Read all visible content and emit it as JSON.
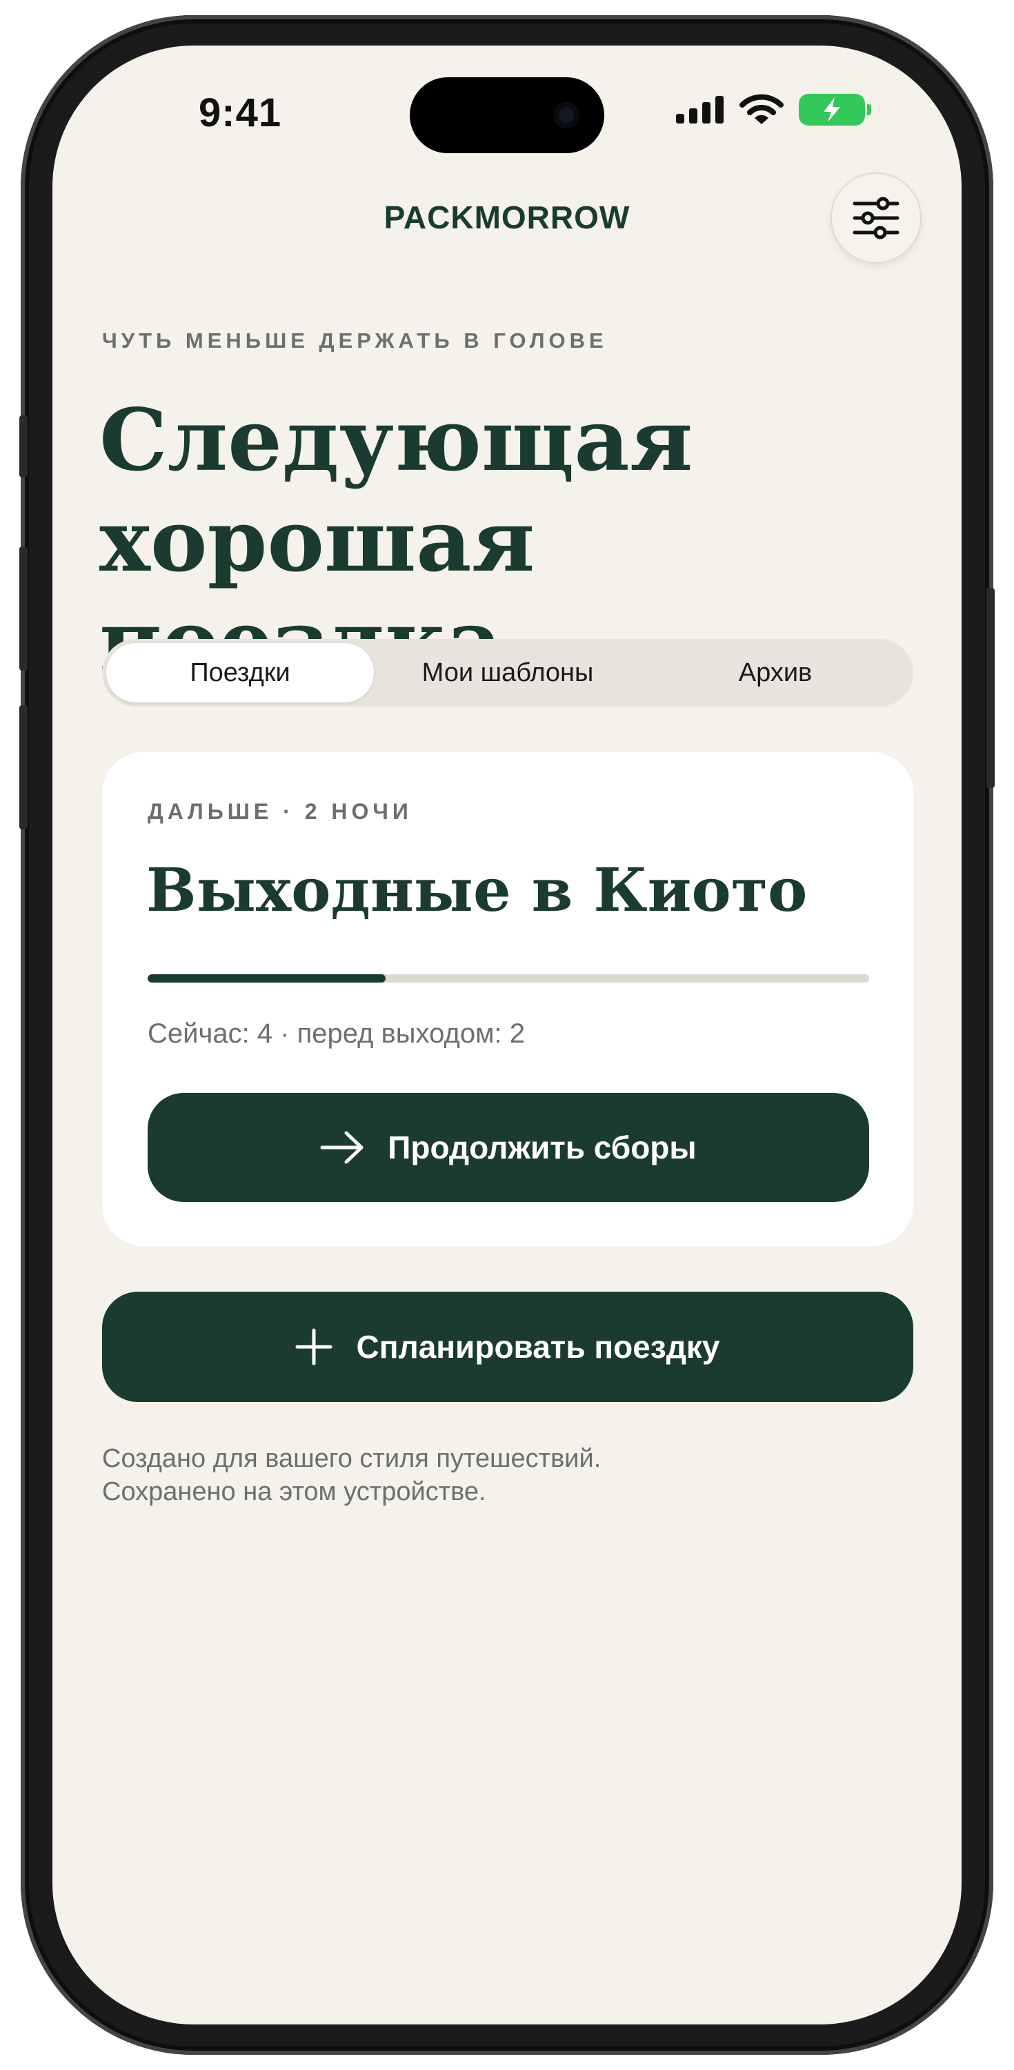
{
  "status_bar": {
    "time": "9:41"
  },
  "header": {
    "app_title": "PACKMORROW",
    "settings_icon": "sliders-icon"
  },
  "hero": {
    "eyebrow": "ЧУТЬ МЕНЬШЕ ДЕРЖАТЬ В ГОЛОВЕ",
    "headline_line1": "Следующая",
    "headline_line2": "хорошая поездка."
  },
  "tabs": [
    {
      "label": "Поездки",
      "active": true
    },
    {
      "label": "Мои шаблоны",
      "active": false
    },
    {
      "label": "Архив",
      "active": false
    }
  ],
  "trip_card": {
    "eyebrow": "ДАЛЬШЕ · 2 НОЧИ",
    "title": "Выходные в Киото",
    "progress_fraction": 0.33,
    "stats": "Сейчас: 4 · перед выходом: 2",
    "continue_button": "Продолжить сборы",
    "continue_icon": "arrow-right-icon"
  },
  "plan_button": {
    "label": "Спланировать поездку",
    "icon": "plus-icon"
  },
  "footer": {
    "line1": "Создано для вашего стиля путешествий.",
    "line2": "Сохранено на этом устройстве."
  },
  "colors": {
    "background": "#f4f2ea",
    "accent": "#1b3b30",
    "muted_text": "#6a716c",
    "battery": "#34c759"
  }
}
